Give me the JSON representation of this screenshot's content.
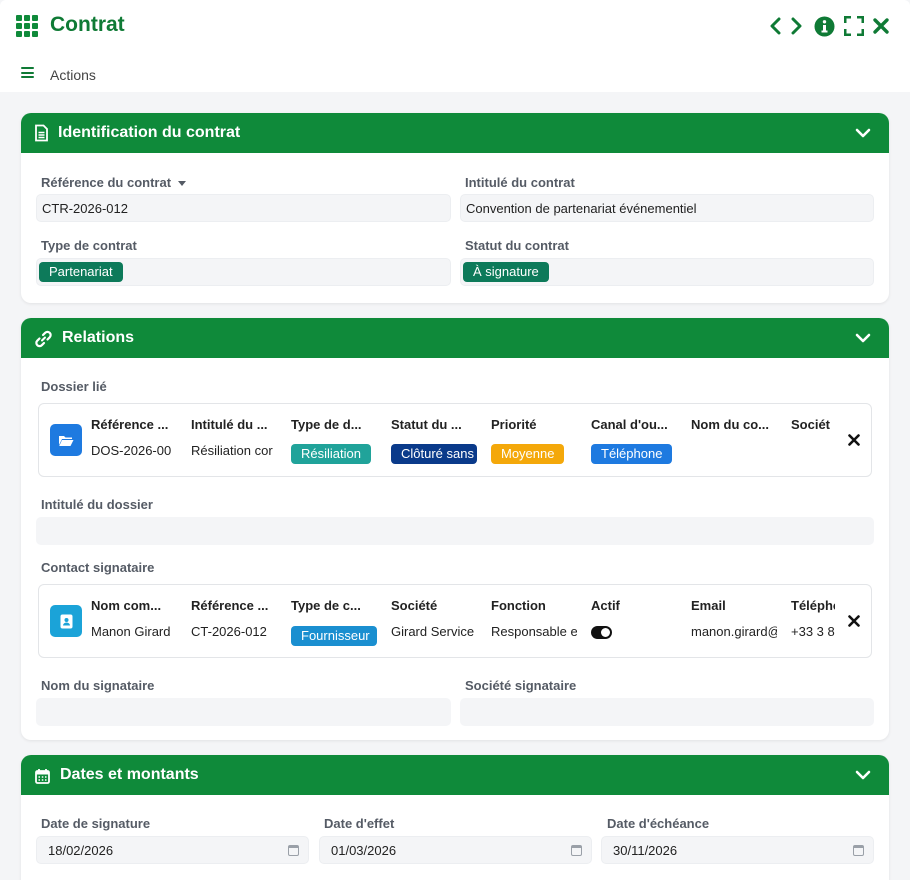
{
  "window": {
    "title": "Contrat"
  },
  "toolbar": {
    "actions_label": "Actions"
  },
  "identification": {
    "title": "Identification du contrat",
    "ref_label": "Référence du contrat",
    "ref_value": "CTR-2026-012",
    "intitule_label": "Intitulé du contrat",
    "intitule_value": "Convention de partenariat événementiel",
    "type_label": "Type de contrat",
    "type_value": "Partenariat",
    "statut_label": "Statut du contrat",
    "statut_value": "À signature"
  },
  "relations": {
    "title": "Relations",
    "dossier_label": "Dossier lié",
    "dossier": {
      "columns": [
        "Référence ...",
        "Intitulé du ...",
        "Type de d...",
        "Statut du ...",
        "Priorité",
        "Canal d'ou...",
        "Nom du co...",
        "Sociét"
      ],
      "values": {
        "reference": "DOS-2026-00",
        "intitule": "Résiliation cor",
        "type": "Résiliation",
        "statut": "Clôturé sans",
        "priorite": "Moyenne",
        "canal": "Téléphone"
      }
    },
    "intitule_dossier_label": "Intitulé du dossier",
    "intitule_dossier_value": "",
    "contact_label": "Contact signataire",
    "contact": {
      "columns": [
        "Nom com...",
        "Référence ...",
        "Type de c...",
        "Société",
        "Fonction",
        "Actif",
        "Email",
        "Télépho"
      ],
      "values": {
        "nom": "Manon Girard",
        "reference": "CT-2026-012",
        "type": "Fournisseur",
        "societe": "Girard Service",
        "fonction": "Responsable e",
        "actif": true,
        "email": "manon.girard@",
        "telephone": "+33 3 8"
      }
    },
    "nom_signataire_label": "Nom du signataire",
    "nom_signataire_value": "",
    "societe_signataire_label": "Société signataire",
    "societe_signataire_value": ""
  },
  "dates": {
    "title": "Dates et montants",
    "signature_label": "Date de signature",
    "signature_value": "18/02/2026",
    "effet_label": "Date d'effet",
    "effet_value": "01/03/2026",
    "echeance_label": "Date d'échéance",
    "echeance_value": "30/11/2026"
  },
  "colors": {
    "brand": "#0f8a3a",
    "tag_type_contrat": "#0d7a5a",
    "tag_resiliation": "#20a39a",
    "tag_cloture": "#0a3a8a",
    "tag_moyenne": "#f4a80a",
    "tag_telephone": "#1e7ae0",
    "tag_fournisseur": "#1a8fd0"
  },
  "icons": [
    "grid-icon",
    "chevron-left-icon",
    "chevron-right-icon",
    "info-icon",
    "fullscreen-icon",
    "close-icon",
    "menu-icon",
    "document-icon",
    "link-icon",
    "calendar-icon",
    "folder-icon",
    "contact-card-icon"
  ]
}
